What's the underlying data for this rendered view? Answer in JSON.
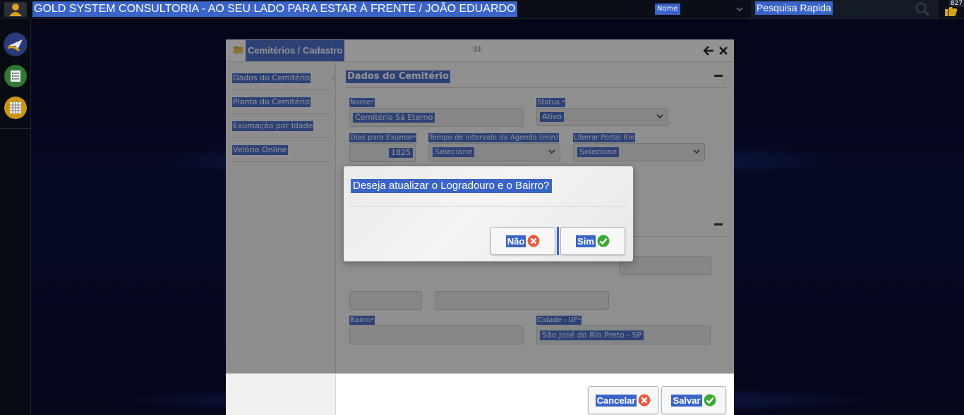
{
  "header": {
    "app_title": "GOLD SYSTEM CONSULTORIA - AO SEU LADO PARA ESTAR À FRENTE / JOÃO EDUARDO",
    "search_type": "Nome",
    "search_placeholder": "Pesquisa Rapida",
    "notification_count": "827"
  },
  "modal": {
    "title": "Cemitérios / Cadastro",
    "nav": [
      {
        "label": "Dados do Cemitério"
      },
      {
        "label": "Planta do Cemitério"
      },
      {
        "label": "Exumação por Idade"
      },
      {
        "label": "Velório Online"
      }
    ],
    "section1_title": "Dados do Cemitério",
    "fields": {
      "nome_label": "Nome",
      "nome_value": "Cemitério Sá Eterno",
      "status_label": "Status",
      "status_value": "Ativo",
      "dias_label": "Dias para Exumar",
      "dias_value": "1825",
      "intervalo_label": "Tempo de Intervalo da Agenda (min)",
      "intervalo_value": "Selecione",
      "portal_label": "Liberar Portal Rio",
      "portal_value": "Selecione",
      "bairro_label": "Bairro",
      "bairro_value": "",
      "cidade_label": "Cidade - UF",
      "cidade_value": "São José do Rio Preto - SP"
    },
    "required_mark": "*",
    "buttons": {
      "cancel": "Cancelar",
      "save": "Salvar"
    }
  },
  "confirm_dialog": {
    "message": "Deseja atualizar o Logradouro e o Bairro?",
    "no_label": "Não",
    "yes_label": "Sim"
  },
  "colors": {
    "selection": "#3a64c8",
    "danger": "#e85c41",
    "success": "#3aaa35"
  }
}
